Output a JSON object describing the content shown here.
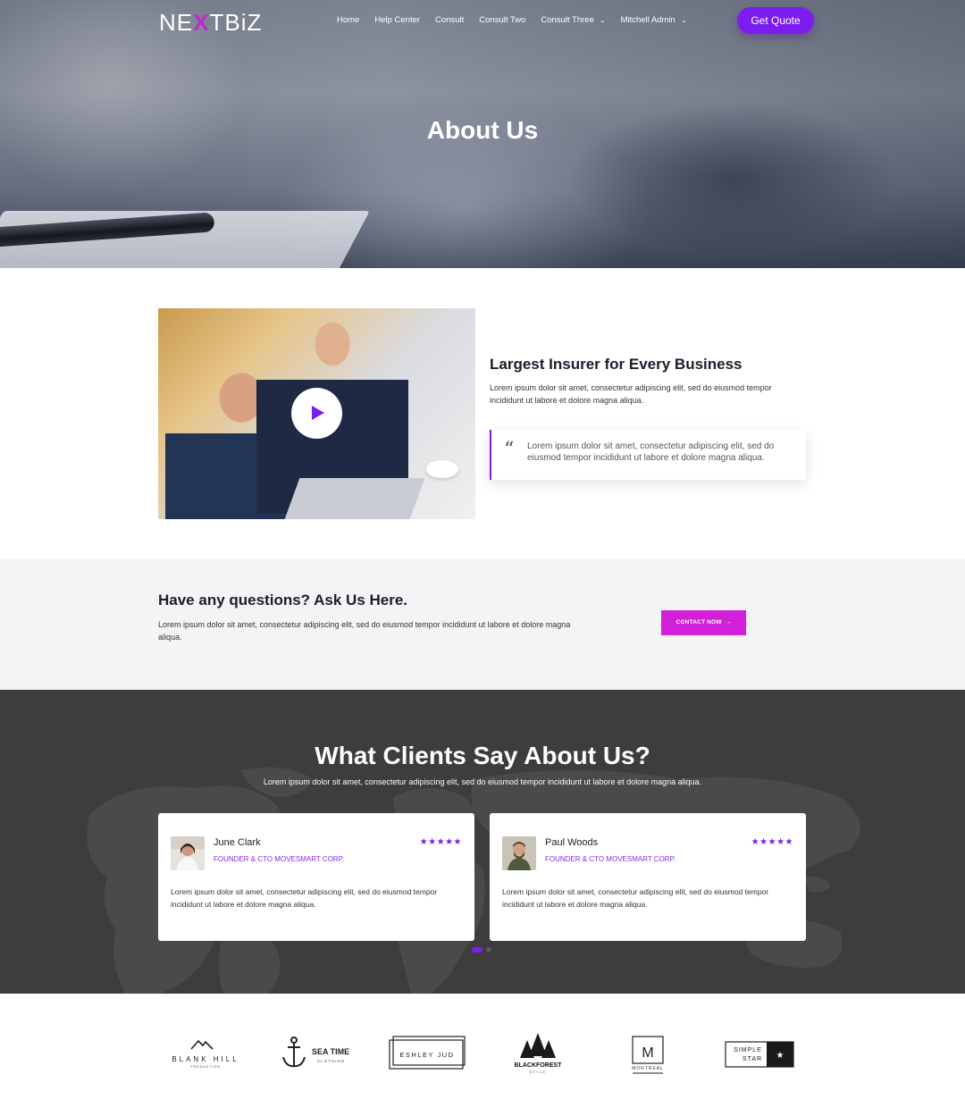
{
  "nav": {
    "logo_pre": "NE",
    "logo_x": "X",
    "logo_post": "TBiZ",
    "menu": [
      "Home",
      "Help Center",
      "Consult",
      "Consult Two",
      "Consult Three"
    ],
    "user": "Mitchell Admin",
    "cta": "Get Quote"
  },
  "hero": {
    "title": "About Us"
  },
  "about": {
    "title": "Largest Insurer for Every Business",
    "text": "Lorem ipsum dolor sit amet, consectetur adipiscing elit, sed do eiusmod tempor incididunt ut labore et dolore magna aliqua.",
    "quote_mark": "“",
    "quote": "Lorem ipsum dolor sit amet, consectetur adipiscing elit, sed do eiusmod tempor incididunt ut labore et dolore magna aliqua."
  },
  "questions": {
    "title": "Have any questions? Ask Us Here.",
    "text": "Lorem ipsum dolor sit amet, consectetur adipiscing elit, sed do eiusmod tempor incididunt ut labore et dolore magna aliqua.",
    "button": "CONTACT NOW"
  },
  "testimonials": {
    "title": "What Clients Say About Us?",
    "subtitle": "Lorem ipsum dolor sit amet, consectetur adipiscing elit, sed do eiusmod tempor incididunt ut labore et dolore magna aliqua.",
    "items": [
      {
        "name": "June Clark",
        "role": "FOUNDER & CTO MOVESMART CORP.",
        "stars": "★★★★★",
        "rating": 5,
        "text": "Lorem ipsum dolor sit amet, consectetur adipiscing elit, sed do eiusmod tempor incididunt ut labore et dolore magna aliqua."
      },
      {
        "name": "Paul Woods",
        "role": "FOUNDER & CTO MOVESMART CORP.",
        "stars": "★★★★★",
        "rating": 5,
        "text": "Lorem ipsum dolor sit amet, consectetur adipiscing elit, sed do eiusmod tempor incididunt ut labore et dolore magna aliqua."
      }
    ]
  },
  "logos": {
    "blank_hill": "BLANK HILL",
    "blank_hill_sub": "PRODUCTION",
    "sea_time": "SEA TIME",
    "sea_time_sub": "CLOTHING",
    "eshley": "ESHLEY JUD",
    "blackforest": "BLACKFOREST",
    "blackforest_sub": "STYLE",
    "montreal_m": "M",
    "montreal": "MONTREAL",
    "simple_1": "SIMPLE",
    "simple_2": "STAR"
  },
  "colors": {
    "accent": "#7c1df0",
    "magenta": "#d21fd9",
    "dark_section": "#3d3d3f",
    "light_section": "#f4f4f6"
  }
}
